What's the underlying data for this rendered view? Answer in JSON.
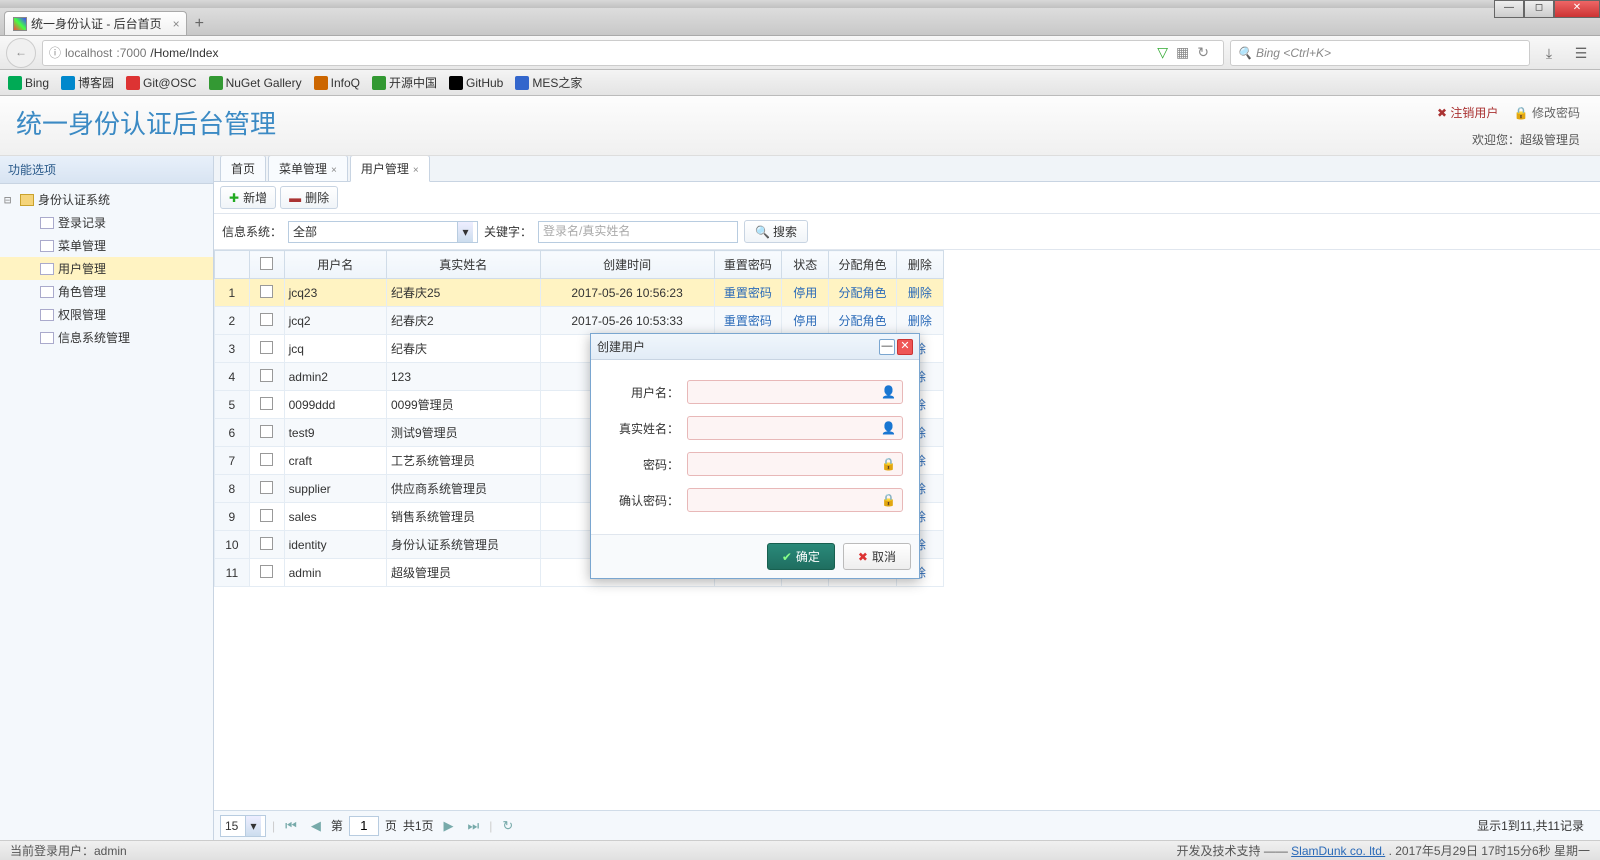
{
  "browser": {
    "tab_title": "统一身份认证 - 后台首页",
    "url_host": "localhost",
    "url_port": ":7000",
    "url_path": "/Home/Index",
    "search_placeholder": "Bing <Ctrl+K>",
    "bookmarks": [
      "Bing",
      "博客园",
      "Git@OSC",
      "NuGet Gallery",
      "InfoQ",
      "开源中国",
      "GitHub",
      "MES之家"
    ]
  },
  "header": {
    "title": "统一身份认证后台管理",
    "logout": "注销用户",
    "change_pwd": "修改密码",
    "welcome": "欢迎您：超级管理员"
  },
  "sidebar": {
    "title": "功能选项",
    "root": "身份认证系统",
    "items": [
      "登录记录",
      "菜单管理",
      "用户管理",
      "角色管理",
      "权限管理",
      "信息系统管理"
    ],
    "selected_index": 2
  },
  "tabs": {
    "items": [
      "首页",
      "菜单管理",
      "用户管理"
    ],
    "active_index": 2
  },
  "toolbar": {
    "add": "新增",
    "delete": "删除"
  },
  "filter": {
    "sys_label": "信息系统：",
    "sys_value": "全部",
    "kw_label": "关键字：",
    "kw_placeholder": "登录名/真实姓名",
    "search": "搜索"
  },
  "grid": {
    "headers": {
      "user": "用户名",
      "realname": "真实姓名",
      "created": "创建时间",
      "reset": "重置密码",
      "status": "状态",
      "role": "分配角色",
      "del": "删除"
    },
    "actions": {
      "reset": "重置密码",
      "disable": "停用",
      "role": "分配角色",
      "del": "删除",
      "del_short": "除"
    },
    "rows": [
      {
        "n": 1,
        "user": "jcq23",
        "name": "纪春庆25",
        "time": "2017-05-26 10:56:23",
        "sel": true,
        "full": true
      },
      {
        "n": 2,
        "user": "jcq2",
        "name": "纪春庆2",
        "time": "2017-05-26 10:53:33",
        "full": true
      },
      {
        "n": 3,
        "user": "jcq",
        "name": "纪春庆",
        "time": "201"
      },
      {
        "n": 4,
        "user": "admin2",
        "name": "123",
        "time": "201"
      },
      {
        "n": 5,
        "user": "0099ddd",
        "name": "0099管理员",
        "time": "201"
      },
      {
        "n": 6,
        "user": "test9",
        "name": "测试9管理员",
        "time": "201"
      },
      {
        "n": 7,
        "user": "craft",
        "name": "工艺系统管理员",
        "time": "201"
      },
      {
        "n": 8,
        "user": "supplier",
        "name": "供应商系统管理员",
        "time": "201"
      },
      {
        "n": 9,
        "user": "sales",
        "name": "销售系统管理员",
        "time": "201"
      },
      {
        "n": 10,
        "user": "identity",
        "name": "身份认证系统管理员",
        "time": "201"
      },
      {
        "n": 11,
        "user": "admin",
        "name": "超级管理员",
        "time": "201"
      }
    ]
  },
  "pager": {
    "page_size": "15",
    "page_label_pre": "第",
    "page_value": "1",
    "page_label_post": "页",
    "total_pages": "共1页",
    "info": "显示1到11,共11记录"
  },
  "dialog": {
    "title": "创建用户",
    "fields": {
      "user": "用户名：",
      "realname": "真实姓名：",
      "pwd": "密码：",
      "pwd2": "确认密码："
    },
    "ok": "确定",
    "cancel": "取消"
  },
  "status": {
    "left": "当前登录用户：admin",
    "support_label": "开发及技术支持 —— ",
    "support_link": "SlamDunk co. ltd.",
    "datetime": "2017年5月29日 17时15分6秒 星期一"
  }
}
